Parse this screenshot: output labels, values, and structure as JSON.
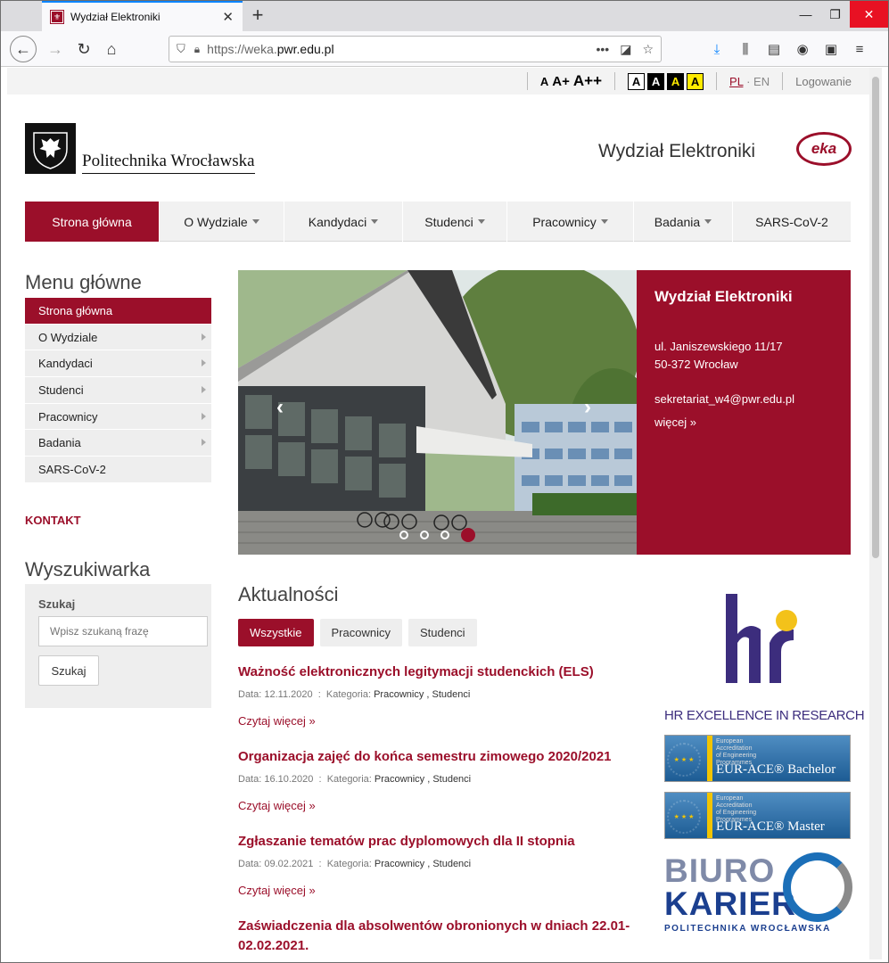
{
  "browser": {
    "tab_title": "Wydział Elektroniki",
    "url_prefix": "https://weka.",
    "url_domain": "pwr.edu.pl",
    "url_actions": [
      "•••",
      "◪",
      "☆"
    ]
  },
  "topbar": {
    "font_small": "A",
    "font_medium": "A+",
    "font_large": "A++",
    "contrast": [
      "A",
      "A",
      "A",
      "A"
    ],
    "lang_pl": "PL",
    "lang_sep": "·",
    "lang_en": "EN",
    "login": "Logowanie"
  },
  "header": {
    "university": "Politechnika Wrocławska",
    "faculty": "Wydział Elektroniki",
    "eka": "eka"
  },
  "mainnav": [
    {
      "label": "Strona główna",
      "active": true
    },
    {
      "label": "O Wydziale"
    },
    {
      "label": "Kandydaci"
    },
    {
      "label": "Studenci"
    },
    {
      "label": "Pracownicy"
    },
    {
      "label": "Badania"
    },
    {
      "label": "SARS-CoV-2"
    }
  ],
  "sidebar": {
    "title": "Menu główne",
    "items": [
      {
        "label": "Strona główna",
        "active": true
      },
      {
        "label": "O Wydziale"
      },
      {
        "label": "Kandydaci"
      },
      {
        "label": "Studenci"
      },
      {
        "label": "Pracownicy"
      },
      {
        "label": "Badania"
      },
      {
        "label": "SARS-CoV-2"
      }
    ],
    "contact": "KONTAKT",
    "search_title": "Wyszukiwarka",
    "search_label": "Szukaj",
    "search_placeholder": "Wpisz szukaną frazę",
    "search_button": "Szukaj"
  },
  "slider": {
    "prev": "‹",
    "next": "›"
  },
  "info": {
    "title": "Wydział Elektroniki",
    "street": "ul. Janiszewskiego 11/17",
    "city": "50-372 Wrocław",
    "email": "sekretariat_w4@pwr.edu.pl",
    "more": "więcej »"
  },
  "news": {
    "title": "Aktualności",
    "filters": [
      "Wszystkie",
      "Pracownicy",
      "Studenci"
    ],
    "items": [
      {
        "title": "Ważność elektronicznych legitymacji studenckich (ELS)",
        "date": "Data: 12.11.2020",
        "category_label": "Kategoria:",
        "categories": "Pracownicy , Studenci",
        "more": "Czytaj więcej »"
      },
      {
        "title": "Organizacja zajęć do końca semestru zimowego 2020/2021",
        "date": "Data: 16.10.2020",
        "category_label": "Kategoria:",
        "categories": "Pracownicy , Studenci",
        "more": "Czytaj więcej »"
      },
      {
        "title": "Zgłaszanie tematów prac dyplomowych dla II stopnia",
        "date": "Data: 09.02.2021",
        "category_label": "Kategoria:",
        "categories": "Pracownicy , Studenci",
        "more": "Czytaj więcej »"
      },
      {
        "title": "Zaświadczenia dla absolwentów obronionych w dniach 22.01-02.02.2021."
      }
    ]
  },
  "logos": {
    "hr_caption": "HR EXCELLENCE IN RESEARCH",
    "eur_small": "European\nAccreditation\nof Engineering\nProgrammes",
    "eur_bachelor": "EUR-ACE® Bachelor",
    "eur_master": "EUR-ACE® Master",
    "biuro_1": "BIURO",
    "biuro_2": "KARIER",
    "biuro_3": "POLITECHNIKA WROCŁAWSKA"
  },
  "colors": {
    "brand": "#9b0f2a"
  }
}
